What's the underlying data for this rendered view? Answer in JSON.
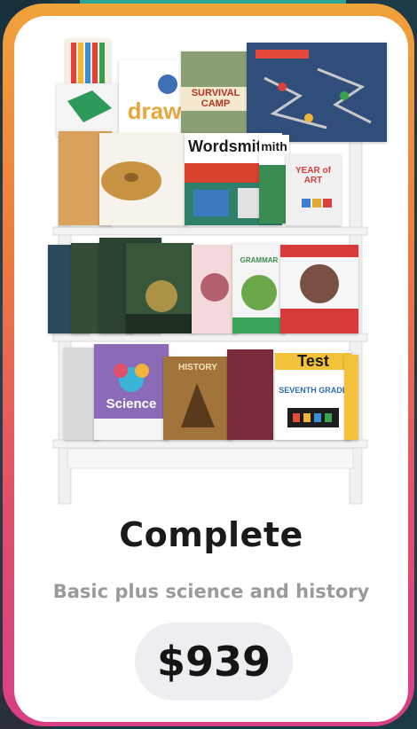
{
  "product": {
    "title": "Complete",
    "subtitle": "Basic plus science and history",
    "price": "$939"
  },
  "book_covers": {
    "draw": "draw",
    "survival": "SURVIVAL CAMP",
    "wordsmith": "Wordsmith",
    "wordsmith2": "mith",
    "year_of_art": "YEAR of ART",
    "grammar": "GRAMMAR",
    "science": "Science",
    "history": "HISTORY",
    "test": "Test",
    "seventh": "SEVENTH GRADE"
  },
  "colors": {
    "frame_gradient": [
      "#f0a23b",
      "#e34e6b",
      "#d83f86"
    ],
    "card": "#ffffff",
    "pill": "#eceef1"
  }
}
